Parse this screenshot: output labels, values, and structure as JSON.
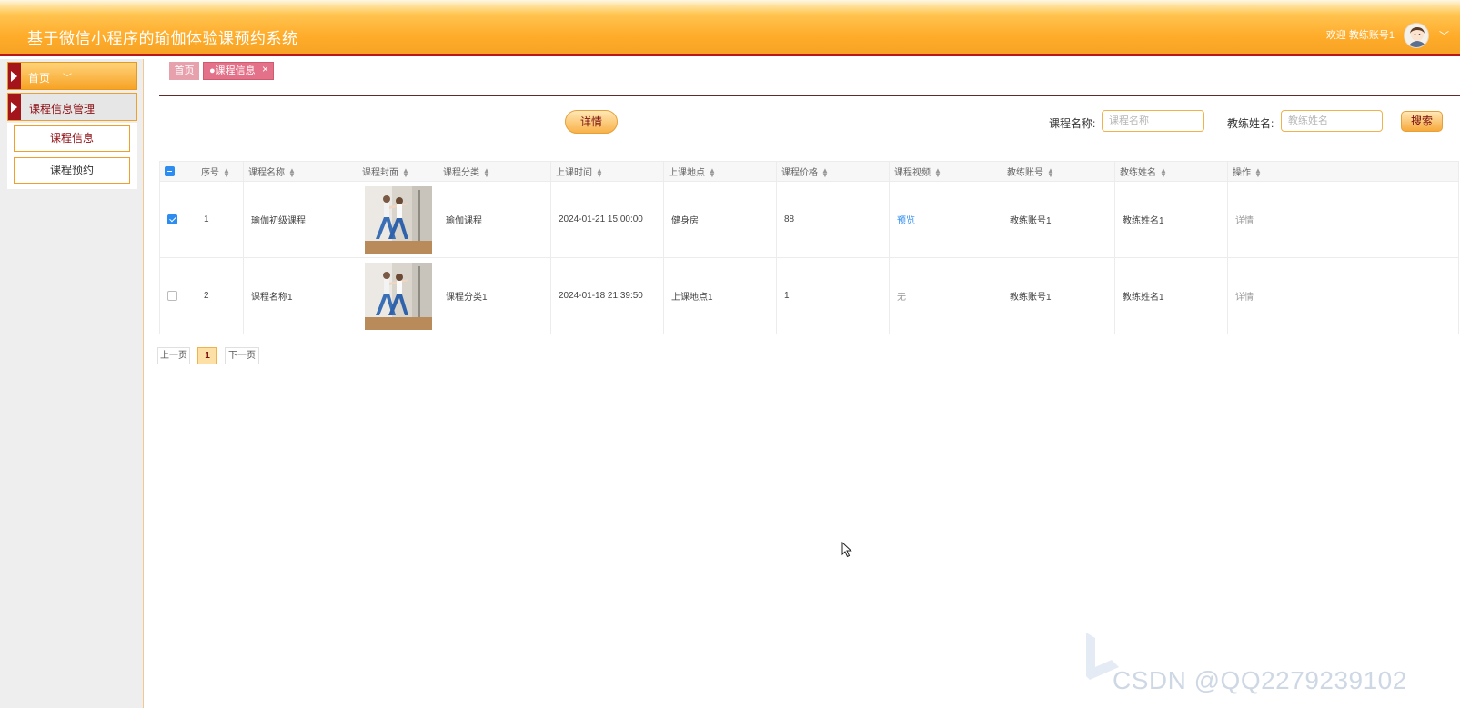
{
  "header": {
    "title": "基于微信小程序的瑜伽体验课预约系统",
    "welcome": "欢迎 教练账号1",
    "chevron": "﹀"
  },
  "sidebar": {
    "home_label": "首页",
    "home_dd": "﹀",
    "group_label": "课程信息管理",
    "items": [
      {
        "label": "课程信息"
      },
      {
        "label": "课程预约"
      }
    ]
  },
  "tabs": [
    {
      "label": "首页"
    },
    {
      "label": "●课程信息",
      "close": "×"
    }
  ],
  "toolbar": {
    "detail_label": "详情",
    "course_name_label": "课程名称:",
    "course_name_placeholder": "课程名称",
    "coach_name_label": "教练姓名:",
    "coach_name_placeholder": "教练姓名",
    "search_label": "搜索"
  },
  "table": {
    "headers": [
      "序号",
      "课程名称",
      "课程封面",
      "课程分类",
      "上课时间",
      "上课地点",
      "课程价格",
      "课程视频",
      "教练账号",
      "教练姓名",
      "操作"
    ],
    "rows": [
      {
        "checked": true,
        "no": "1",
        "name": "瑜伽初级课程",
        "category": "瑜伽课程",
        "time": "2024-01-21 15:00:00",
        "place": "健身房",
        "price": "88",
        "video": "预览",
        "coach_account": "教练账号1",
        "coach_name": "教练姓名1",
        "action": "详情"
      },
      {
        "checked": false,
        "no": "2",
        "name": "课程名称1",
        "category": "课程分类1",
        "time": "2024-01-18 21:39:50",
        "place": "上课地点1",
        "price": "1",
        "video": "无",
        "coach_account": "教练账号1",
        "coach_name": "教练姓名1",
        "action": "详情"
      }
    ]
  },
  "pager": {
    "prev": "上一页",
    "current": "1",
    "next": "下一页"
  },
  "watermark": "CSDN @QQ2279239102",
  "colors": {
    "header_orange": "#f7a325",
    "header_border": "#b8161b",
    "accent_dark_red": "#8e0f14",
    "tab_pink": "#e4718a",
    "link_blue": "#2d8cf0"
  }
}
